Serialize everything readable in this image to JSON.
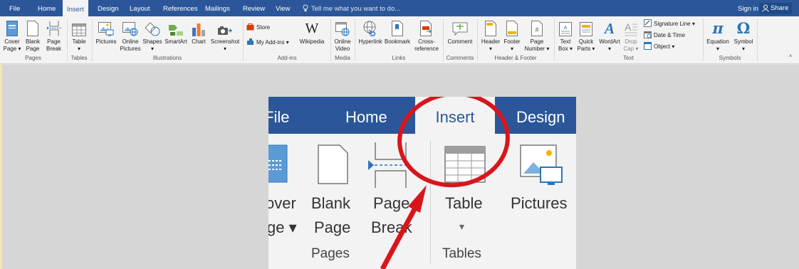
{
  "tabs": [
    "File",
    "Home",
    "Insert",
    "Design",
    "Layout",
    "References",
    "Mailings",
    "Review",
    "View"
  ],
  "tell_me": "Tell me what you want to do...",
  "sign_in": "Sign in",
  "share": "Share",
  "groups": {
    "pages": "Pages",
    "tables": "Tables",
    "illustrations": "Illustrations",
    "addins": "Add-ins",
    "media": "Media",
    "links": "Links",
    "comments": "Comments",
    "header_footer": "Header & Footer",
    "text": "Text",
    "symbols": "Symbols"
  },
  "buttons": {
    "cover_page": [
      "Cover",
      "Page ▾"
    ],
    "blank_page": [
      "Blank",
      "Page"
    ],
    "page_break": [
      "Page",
      "Break"
    ],
    "table": [
      "Table",
      "▾"
    ],
    "pictures": "Pictures",
    "online_pictures": [
      "Online",
      "Pictures"
    ],
    "shapes": [
      "Shapes",
      "▾"
    ],
    "smartart": "SmartArt",
    "chart": "Chart",
    "screenshot": [
      "Screenshot",
      "▾"
    ],
    "store": "Store",
    "my_addins": "My Add-ins  ▾",
    "wikipedia": "Wikipedia",
    "online_video": [
      "Online",
      "Video"
    ],
    "hyperlink": "Hyperlink",
    "bookmark": "Bookmark",
    "cross_reference": [
      "Cross-",
      "reference"
    ],
    "comment": "Comment",
    "header": [
      "Header",
      "▾"
    ],
    "footer": [
      "Footer",
      "▾"
    ],
    "page_number": [
      "Page",
      "Number ▾"
    ],
    "text_box": [
      "Text",
      "Box ▾"
    ],
    "quick_parts": [
      "Quick",
      "Parts ▾"
    ],
    "wordart": [
      "WordArt",
      "▾"
    ],
    "drop_cap": [
      "Drop",
      "Cap ▾"
    ],
    "signature_line": "Signature Line  ▾",
    "date_time": "Date & Time",
    "object": "Object  ▾",
    "equation": [
      "Equation",
      "▾"
    ],
    "symbol": [
      "Symbol",
      "▾"
    ]
  },
  "zoom": {
    "tabs": [
      "File",
      "Home",
      "Insert",
      "Design"
    ],
    "cover": [
      "over",
      "ge ▾"
    ],
    "blank": [
      "Blank",
      "Page"
    ],
    "page_break": [
      "Page",
      "Break"
    ],
    "table": [
      "Table",
      "▾"
    ],
    "pictures": "Pictures",
    "group_pages": "Pages",
    "group_tables": "Tables"
  },
  "colors": {
    "accent": "#2b579a",
    "annotation": "#d9151b"
  }
}
